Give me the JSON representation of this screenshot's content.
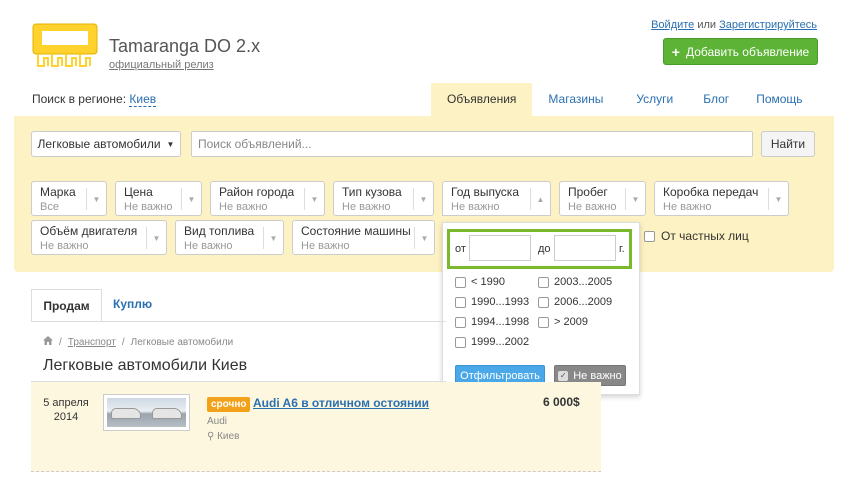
{
  "header": {
    "logo_title": "Tamaranga DO 2.x",
    "logo_subtitle": "официальный релиз",
    "login": "Войдите",
    "or": "или",
    "register": "Зарегистрируйтесь",
    "add_button": "Добавить объявление",
    "add_icon": "plus-icon",
    "accent_color": "#5cb335"
  },
  "region": {
    "label": "Поиск в регионе:",
    "value": "Киев"
  },
  "nav": {
    "tabs": [
      "Объявления",
      "Магазины",
      "Услуги",
      "Блог",
      "Помощь"
    ],
    "active": "Объявления"
  },
  "search": {
    "category": "Легковые автомобили",
    "placeholder": "Поиск объявлений...",
    "button": "Найти",
    "panel_color": "#fdf2c3"
  },
  "filters": [
    {
      "label": "Марка",
      "value": "Все"
    },
    {
      "label": "Цена",
      "value": "Не важно"
    },
    {
      "label": "Район города",
      "value": "Не важно"
    },
    {
      "label": "Тип кузова",
      "value": "Не важно"
    },
    {
      "label": "Год выпуска",
      "value": "Не важно"
    },
    {
      "label": "Пробег",
      "value": "Не важно"
    },
    {
      "label": "Коробка передач",
      "value": "Не важно"
    },
    {
      "label": "Объём двигателя",
      "value": "Не важно"
    },
    {
      "label": "Вид топлива",
      "value": "Не важно"
    },
    {
      "label": "Состояние машины",
      "value": "Не важно"
    }
  ],
  "private_only": {
    "label": "От частных лиц",
    "checked": false
  },
  "year_dropdown": {
    "from": "от",
    "to": "до",
    "unit": "г.",
    "from_value": "",
    "to_value": "",
    "options": [
      "< 1990",
      "1990...1993",
      "1994...1998",
      "1999...2002",
      "2003...2005",
      "2006...2009",
      "> 2009"
    ],
    "apply_button": "Отфильтровать",
    "any_button": "Не важно",
    "highlight_color": "#7ab92b"
  },
  "listing_tabs": {
    "sell": "Продам",
    "buy": "Куплю"
  },
  "breadcrumb": {
    "home_icon": "home-icon",
    "items": [
      "Транспорт",
      "Легковые автомобили"
    ]
  },
  "page_title": "Легковые автомобили Киев",
  "listing": {
    "date_day": "5 апреля",
    "date_year": "2014",
    "badge": "срочно",
    "title": "Audi A6 в отличном остоянии",
    "brand": "Audi",
    "city": "Киев",
    "city_icon": "location-pin-icon",
    "price": "6 000$"
  }
}
